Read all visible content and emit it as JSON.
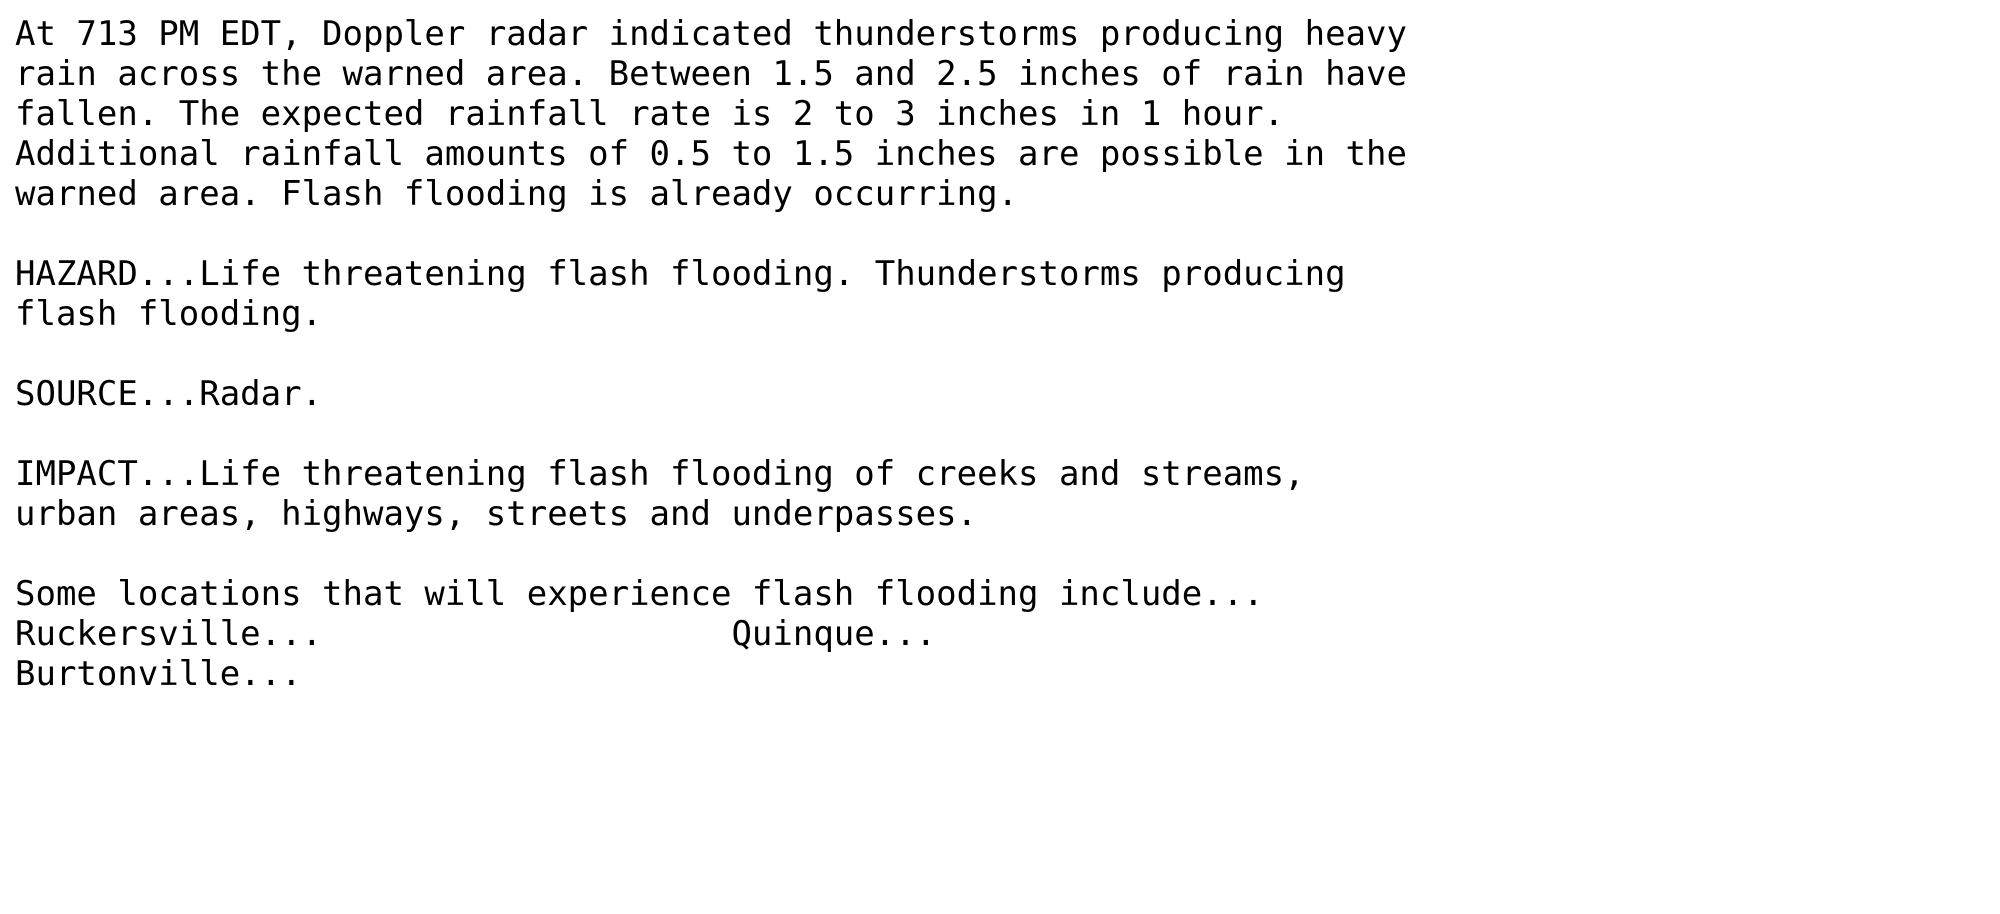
{
  "document": {
    "type": "nws-warning-text",
    "background_color": "#ffffff",
    "text_color": "#000000",
    "product": "Flash Flood Warning statement body",
    "issuance_time": "713 PM EDT",
    "lines": [
      "At 713 PM EDT, Doppler radar indicated thunderstorms producing heavy",
      "rain across the warned area. Between 1.5 and 2.5 inches of rain have",
      "fallen. The expected rainfall rate is 2 to 3 inches in 1 hour.",
      "Additional rainfall amounts of 0.5 to 1.5 inches are possible in the",
      "warned area. Flash flooding is already occurring.",
      "",
      "HAZARD...Life threatening flash flooding. Thunderstorms producing",
      "flash flooding.",
      "",
      "SOURCE...Radar.",
      "",
      "IMPACT...Life threatening flash flooding of creeks and streams,",
      "urban areas, highways, streets and underpasses.",
      "",
      "Some locations that will experience flash flooding include...",
      "Ruckersville...                    Quinque...",
      "Burtonville..."
    ],
    "sections": {
      "radar_statement": {
        "time": "713 PM EDT",
        "source_instrument": "Doppler radar",
        "rain_fallen_range_inches": "1.5 and 2.5",
        "expected_rate_inches_per_hour": "2 to 3",
        "additional_rainfall_inches": "0.5 to 1.5",
        "status": "Flash flooding is already occurring."
      },
      "hazard": {
        "label": "HAZARD...",
        "value": "Life threatening flash flooding. Thunderstorms producing flash flooding."
      },
      "source": {
        "label": "SOURCE...",
        "value": "Radar."
      },
      "impact": {
        "label": "IMPACT...",
        "value": "Life threatening flash flooding of creeks and streams, urban areas, highways, streets and underpasses."
      },
      "locations": {
        "intro": "Some locations that will experience flash flooding include...",
        "items": [
          "Ruckersville...",
          "Quinque...",
          "Burtonville..."
        ]
      }
    }
  }
}
